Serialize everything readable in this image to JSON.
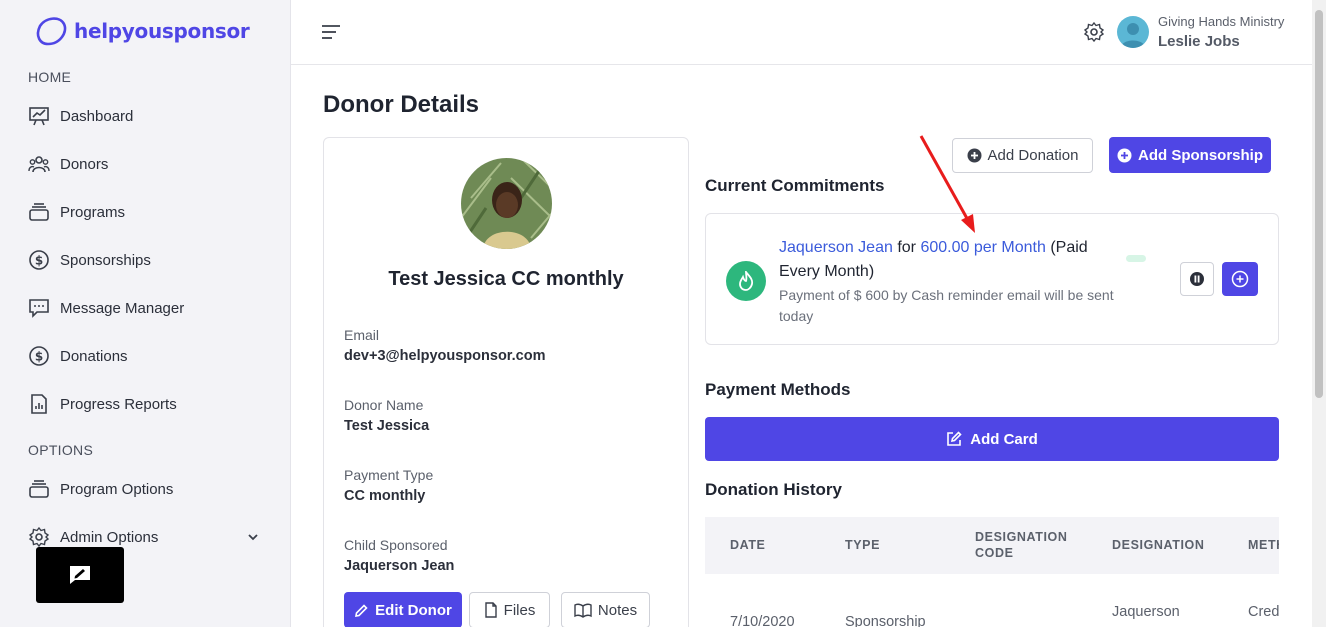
{
  "brand": {
    "name": "helpyousponsor",
    "color": "#4f46e5"
  },
  "sidebar": {
    "home_label": "HOME",
    "options_label": "OPTIONS",
    "items": [
      {
        "label": "Dashboard",
        "icon": "presentation-chart-icon"
      },
      {
        "label": "Donors",
        "icon": "users-icon"
      },
      {
        "label": "Programs",
        "icon": "stack-icon"
      },
      {
        "label": "Sponsorships",
        "icon": "dollar-circle-icon"
      },
      {
        "label": "Message Manager",
        "icon": "message-icon"
      },
      {
        "label": "Donations",
        "icon": "dollar-circle-icon"
      },
      {
        "label": "Progress Reports",
        "icon": "report-icon"
      }
    ],
    "option_items": [
      {
        "label": "Program Options",
        "icon": "stack-icon"
      },
      {
        "label": "Admin Options",
        "icon": "gear-icon"
      }
    ]
  },
  "header": {
    "organization": "Giving Hands Ministry",
    "user_name": "Leslie Jobs"
  },
  "page": {
    "title": "Donor Details"
  },
  "donor": {
    "full_name": "Test Jessica CC monthly",
    "fields": [
      {
        "label": "Email",
        "value": "dev+3@helpyousponsor.com"
      },
      {
        "label": "Donor Name",
        "value": "Test Jessica"
      },
      {
        "label": "Payment Type",
        "value": "CC monthly"
      },
      {
        "label": "Child Sponsored",
        "value": "Jaquerson Jean"
      }
    ],
    "edit_label": "Edit Donor",
    "files_label": "Files",
    "notes_label": "Notes"
  },
  "actions": {
    "add_donation": "Add Donation",
    "add_sponsorship": "Add Sponsorship"
  },
  "commitments": {
    "title": "Current Commitments",
    "items": [
      {
        "child": "Jaquerson Jean",
        "for": "for",
        "amount": "600.00 per Month",
        "frequency": "(Paid Every Month)",
        "note": "Payment of $ 600 by Cash reminder email will be sent today"
      }
    ]
  },
  "payment_methods": {
    "title": "Payment Methods",
    "add_card": "Add Card"
  },
  "donation_history": {
    "title": "Donation History",
    "columns": [
      "DATE",
      "TYPE",
      "DESIGNATION CODE",
      "DESIGNATION",
      "METHOD"
    ],
    "rows": [
      {
        "date": "7/10/2020",
        "type": "Sponsorship",
        "code": "",
        "designation": "Jaquerson",
        "method": "Credit"
      }
    ]
  },
  "colors": {
    "accent": "#4f46e5",
    "success": "#2db77d",
    "link": "#3b5bdb",
    "annotation": "#e81c1c"
  }
}
